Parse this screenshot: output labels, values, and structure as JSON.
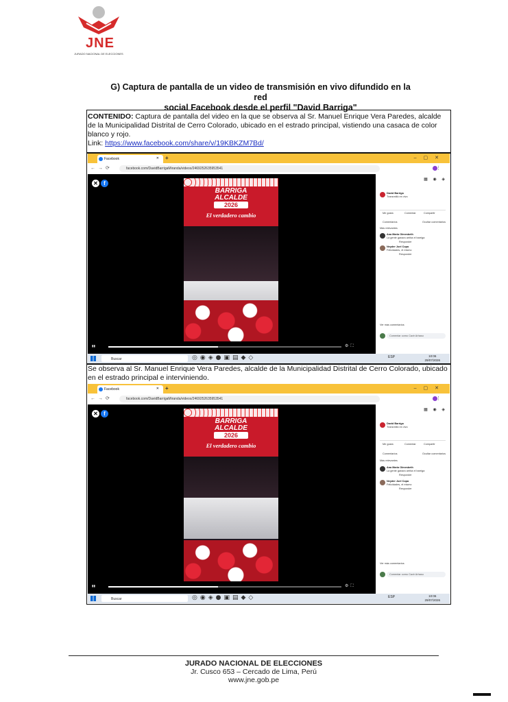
{
  "logo": {
    "text": "JNE",
    "subtitle": "JURADO NACIONAL DE ELECCIONES",
    "color_red": "#d52b2b"
  },
  "heading": {
    "line1": "G)  Captura de pantalla de un video de transmisión en vivo difundido en la red",
    "line2": "social Facebook desde el perfil \"David Barriga\""
  },
  "row1": {
    "label": "CONTENIDO:",
    "text": " Captura de pantalla del video en la que se observa al Sr. Manuel Enrique Vera Paredes, alcalde de la Municipalidad Distrital de Cerro Colorado, ubicado en el estrado principal, vistiendo una casaca de color blanco y rojo.",
    "link_label": "Link: ",
    "link": "https://www.facebook.com/share/v/19KBKZM7Bd/"
  },
  "row2": {
    "text": "Se observa al Sr. Manuel Enrique Vera Paredes, alcalde de la Municipalidad Distrital de Cerro Colorado, ubicado en el estrado principal e interviniendo."
  },
  "browser": {
    "tab_title": "Facebook",
    "url": "facebook.com/DavidBarrigaMiranda/videos/2469252635953541",
    "video_title_1": "BARRIGA",
    "video_title_2": "ALCALDE",
    "video_year": "2026",
    "video_slogan": "El verdadero cambio",
    "sidebar_name": "David Barriga",
    "sidebar_meta": "Transmitió en vivo",
    "like": "Me gusta",
    "comment": "Comentar",
    "share": "Compartir",
    "comments_link": "Comentarios",
    "comments_ctrl": "Ocultar comentarios",
    "relevant": "Más relevantes",
    "c1_name": "Ana Maria Olmesbeth",
    "c1_text": "La gente ganara arriba el barriga",
    "c1_reply": "Responder",
    "c2_name": "Neyder Joel Copa",
    "c2_text": "Felicidades, el mismo",
    "c2_reply": "Responder",
    "view_more": "Ver más comentarios",
    "comment_as": "Comentar como Cavir Arhaso",
    "search": "Buscar",
    "lang": "ESP",
    "time1": "10:06",
    "date1": "29/07/2026",
    "time2": "10:06",
    "date2": "29/07/2026"
  },
  "footer": {
    "title": "JURADO NACIONAL DE ELECCIONES",
    "address": "Jr. Cusco 653 – Cercado de Lima, Perú",
    "web": "www.jne.gob.pe"
  }
}
